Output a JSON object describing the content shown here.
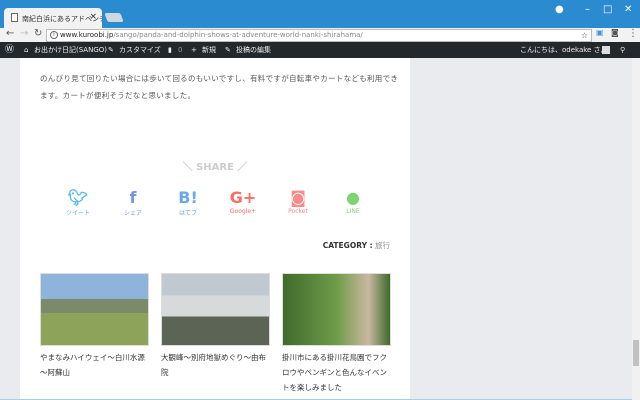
{
  "browser": {
    "tab_title": "南紀白浜にあるアドベンチャ…",
    "url_domain": "www.kuroobi.jp",
    "url_path": "/sango/panda-and-dolphin-shows-at-adventure-world-nanki-shirahama/"
  },
  "adminbar": {
    "site": "お出かけ日記(SANGO)",
    "customize": "カスタマイズ",
    "comments": "0",
    "new": "新規",
    "edit": "投稿の編集",
    "greeting": "こんにちは、odekake さん"
  },
  "article": {
    "paragraph": "のんびり見て回りたい場合には歩いて回るのもいいですし、有料ですが自転車やカートなども利用できます。カートが便利そうだなと思いました。"
  },
  "share": {
    "title": "＼ SHARE ／",
    "buttons": [
      {
        "label": "ツイート",
        "icon": "twitter-icon",
        "color": "#5bb8f5"
      },
      {
        "label": "シェア",
        "icon": "facebook-icon",
        "color": "#7397e6"
      },
      {
        "label": "はてブ",
        "icon": "hatena-icon",
        "color": "#6aa7ee"
      },
      {
        "label": "Google+",
        "icon": "google-plus-icon",
        "color": "#fa6d62"
      },
      {
        "label": "Pocket",
        "icon": "pocket-icon",
        "color": "#f98b8b"
      },
      {
        "label": "LINE",
        "icon": "line-icon",
        "color": "#7ed470"
      }
    ]
  },
  "category": {
    "label": "CATEGORY :",
    "value": "旅行"
  },
  "related": [
    {
      "title": "やまなみハイウェイ～白川水源～阿蘇山"
    },
    {
      "title": "大観峰～別府地獄めぐり～由布院"
    },
    {
      "title": "掛川市にある掛川花鳥園でフクロウやペンギンと色んなイベントを楽しみました"
    }
  ]
}
